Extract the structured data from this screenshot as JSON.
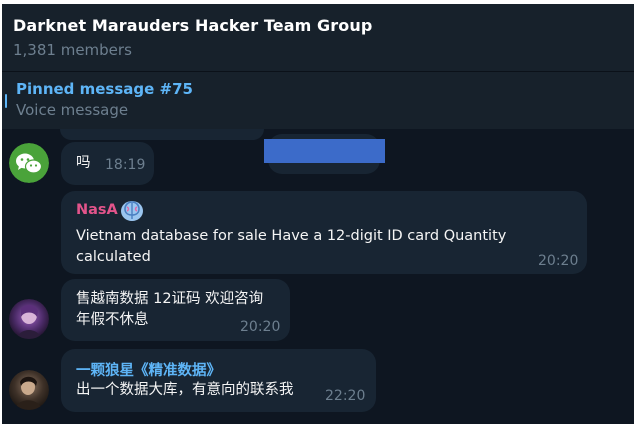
{
  "header": {
    "title": "Darknet Marauders Hacker Team Group",
    "members": "1,381 members"
  },
  "pinned": {
    "title": "Pinned message #75",
    "subtitle": "Voice message"
  },
  "messages": [
    {
      "text": "吗",
      "time": "18:19",
      "avatar_icon": "wechat-icon"
    },
    {
      "sender": "NasA",
      "sender_color": "#e3548b",
      "sender_badge_icon": "brain-icon",
      "text_lines": [
        "Vietnam database for sale Have a 12-digit ID card Quantity",
        "calculated"
      ],
      "time": "20:20"
    },
    {
      "text_lines": [
        "售越南数据 12证码  欢迎咨询",
        "年假不休息"
      ],
      "time": "20:20"
    },
    {
      "sender": "一颗狼星《精准数据》",
      "sender_color": "#5eb5f7",
      "text": "出一个数据大库，有意向的联系我",
      "time": "22:20"
    }
  ],
  "colors": {
    "chat_bg": "#0e1621",
    "header_bg": "#17212b",
    "bubble_bg": "#182533",
    "accent": "#5eb5f7",
    "redaction": "#3c6bc9"
  }
}
